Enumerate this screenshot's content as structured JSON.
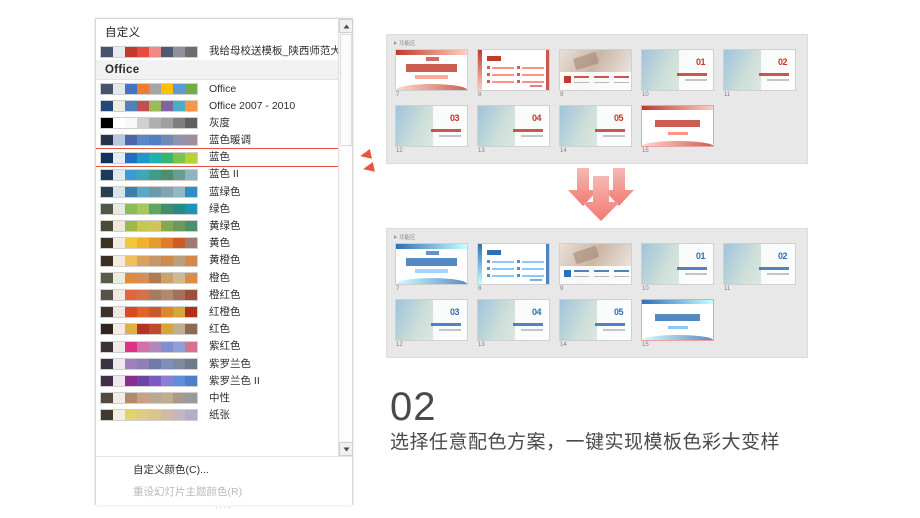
{
  "color_panel": {
    "groups": [
      {
        "title": "自定义",
        "style": "plain"
      },
      {
        "title": "Office",
        "style": "header"
      }
    ],
    "custom_items": [
      {
        "label": "我给母校送模板_陕西师范大学",
        "colors": [
          "#46546b",
          "#e8eaec",
          "#c0392b",
          "#e74c3c",
          "#f08a85",
          "#4e5a70",
          "#8d929c",
          "#6d6d6d"
        ]
      }
    ],
    "office_items": [
      {
        "label": "Office",
        "colors": [
          "#44546a",
          "#e7e6e6",
          "#4472c4",
          "#ed7d31",
          "#a5a5a5",
          "#ffc000",
          "#5b9bd5",
          "#70ad47"
        ],
        "selected": false
      },
      {
        "label": "Office 2007 - 2010",
        "colors": [
          "#1f497d",
          "#eeece1",
          "#4f81bd",
          "#c0504d",
          "#9bbb59",
          "#8064a2",
          "#4bacc6",
          "#f79646"
        ],
        "selected": false
      },
      {
        "label": "灰度",
        "colors": [
          "#000000",
          "#ffffff",
          "#f8f8f8",
          "#d0d0d0",
          "#b0b0b0",
          "#a0a0a0",
          "#7f7f7f",
          "#5f5f5f"
        ],
        "selected": false
      },
      {
        "label": "蓝色暖调",
        "colors": [
          "#24344d",
          "#b7c8e0",
          "#4a66ac",
          "#5b87c9",
          "#4f7fc4",
          "#6f8cb8",
          "#8f93ad",
          "#a08e9e"
        ],
        "selected": false
      },
      {
        "label": "蓝色",
        "colors": [
          "#16325c",
          "#e4edf5",
          "#1f6fc4",
          "#2196c9",
          "#21b0b0",
          "#35b86e",
          "#7ec24a",
          "#b5d335"
        ],
        "selected": true
      },
      {
        "label": "蓝色 II",
        "colors": [
          "#1a3b5c",
          "#dfe9f0",
          "#3d9bd4",
          "#40a8b5",
          "#3f9b8a",
          "#4f8e6a",
          "#6c9c8f",
          "#8fb3bf"
        ],
        "selected": false
      },
      {
        "label": "蓝绿色",
        "colors": [
          "#2c3f52",
          "#d7e3ec",
          "#3e7fa8",
          "#5aa9c5",
          "#6c9aa8",
          "#7fa5ae",
          "#94b7c4",
          "#2f8fc4"
        ],
        "selected": false
      },
      {
        "label": "绿色",
        "colors": [
          "#50584a",
          "#e9eade",
          "#8dbb5a",
          "#a7c85e",
          "#5fa662",
          "#3f8f6d",
          "#2a8a83",
          "#1f93b5"
        ],
        "selected": false
      },
      {
        "label": "黄绿色",
        "colors": [
          "#4b4b35",
          "#eceade",
          "#9fb84c",
          "#c5c84f",
          "#d2c45a",
          "#86a84d",
          "#6b9a5a",
          "#4d8f68"
        ],
        "selected": false
      },
      {
        "label": "黄色",
        "colors": [
          "#3b3322",
          "#f0ece2",
          "#f5c63a",
          "#f2b128",
          "#e89a2c",
          "#e07b2c",
          "#cf5b28",
          "#9c7e6e"
        ],
        "selected": false
      },
      {
        "label": "黄橙色",
        "colors": [
          "#3b2f1f",
          "#f2ece0",
          "#f0c05a",
          "#d9a05f",
          "#c79668",
          "#cf8a4a",
          "#b9a07c",
          "#d4884a"
        ],
        "selected": false
      },
      {
        "label": "橙色",
        "colors": [
          "#5b5b4a",
          "#ececdd",
          "#e08a3c",
          "#d98e57",
          "#b27a52",
          "#c9a36a",
          "#cdbb92",
          "#d88f45"
        ],
        "selected": false
      },
      {
        "label": "橙红色",
        "colors": [
          "#575148",
          "#efe9e2",
          "#e06640",
          "#d4714e",
          "#a87a5e",
          "#b08a6d",
          "#a3705c",
          "#9c4f3a"
        ],
        "selected": false
      },
      {
        "label": "红橙色",
        "colors": [
          "#3d332a",
          "#f0e9e0",
          "#d94a20",
          "#e2632a",
          "#c95a30",
          "#e0862c",
          "#d3a83b",
          "#b12f14"
        ],
        "selected": false
      },
      {
        "label": "红色",
        "colors": [
          "#2f2420",
          "#f2ece2",
          "#e0b23c",
          "#b53225",
          "#c24a2c",
          "#d6a33c",
          "#c1ae8a",
          "#8c6a55"
        ],
        "selected": false
      },
      {
        "label": "紫红色",
        "colors": [
          "#3a3236",
          "#f0e9ec",
          "#e0308a",
          "#d66fa8",
          "#b089bb",
          "#7f8fd0",
          "#8fa0d8",
          "#d4738f"
        ],
        "selected": false
      },
      {
        "label": "紫罗兰色",
        "colors": [
          "#3a3240",
          "#ece9f0",
          "#a07fc0",
          "#8f7fb5",
          "#6f7aab",
          "#7f8fbb",
          "#7b8aa0",
          "#6e7b8a"
        ],
        "selected": false
      },
      {
        "label": "紫罗兰色 II",
        "colors": [
          "#3f2d4a",
          "#efe8f2",
          "#8a2f8f",
          "#6f46a8",
          "#7a5cc4",
          "#8a7fd4",
          "#5f8fd8",
          "#4f7fc9"
        ],
        "selected": false
      },
      {
        "label": "中性",
        "colors": [
          "#55483f",
          "#f1ece5",
          "#b08a6a",
          "#c9a184",
          "#b9a897",
          "#c2ae8f",
          "#a89a8c",
          "#9a9a9a"
        ],
        "selected": false
      },
      {
        "label": "纸张",
        "colors": [
          "#3f3a2f",
          "#f3efe0",
          "#e0d46a",
          "#e2c98a",
          "#d9c68f",
          "#d2b9a0",
          "#c4b5c0",
          "#b0aec8"
        ],
        "selected": false
      }
    ],
    "footer": {
      "custom_colors": "自定义颜色(C)...",
      "reset_theme": "重设幻灯片主题颜色(R)",
      "dots": "...."
    },
    "scrollbar": {
      "up_icon": "triangle-up-icon",
      "down_icon": "triangle-down-icon"
    }
  },
  "sorter_top": {
    "caption": "功能区",
    "accent": "#c0392b",
    "thumbs": [
      {
        "num": "7",
        "kind": "cover",
        "active": false
      },
      {
        "num": "8",
        "kind": "agenda",
        "active": false
      },
      {
        "num": "9",
        "kind": "photo-split",
        "active": false
      },
      {
        "num": "10",
        "kind": "section",
        "big": "01",
        "active": false
      },
      {
        "num": "11",
        "kind": "section",
        "big": "02",
        "active": false
      },
      {
        "num": "12",
        "kind": "section",
        "big": "03",
        "active": false
      },
      {
        "num": "13",
        "kind": "section",
        "big": "04",
        "active": false
      },
      {
        "num": "14",
        "kind": "section",
        "big": "05",
        "active": false
      },
      {
        "num": "15",
        "kind": "thanks",
        "active": true
      }
    ]
  },
  "sorter_bottom": {
    "caption": "功能区",
    "accent": "#2f6fb5",
    "thumbs": [
      {
        "num": "7",
        "kind": "cover",
        "active": false
      },
      {
        "num": "8",
        "kind": "agenda",
        "active": false
      },
      {
        "num": "9",
        "kind": "photo-split",
        "active": false
      },
      {
        "num": "10",
        "kind": "section",
        "big": "01",
        "active": false
      },
      {
        "num": "11",
        "kind": "section",
        "big": "02",
        "active": false
      },
      {
        "num": "12",
        "kind": "section",
        "big": "03",
        "active": false
      },
      {
        "num": "13",
        "kind": "section",
        "big": "04",
        "active": false
      },
      {
        "num": "14",
        "kind": "section",
        "big": "05",
        "active": false
      },
      {
        "num": "15",
        "kind": "thanks",
        "active": true
      }
    ]
  },
  "transition": {
    "icon": "down-arrows-icon",
    "color": "#f08080"
  },
  "caption": {
    "number": "02",
    "text": "选择任意配色方案，一键实现模板色彩大变样"
  }
}
